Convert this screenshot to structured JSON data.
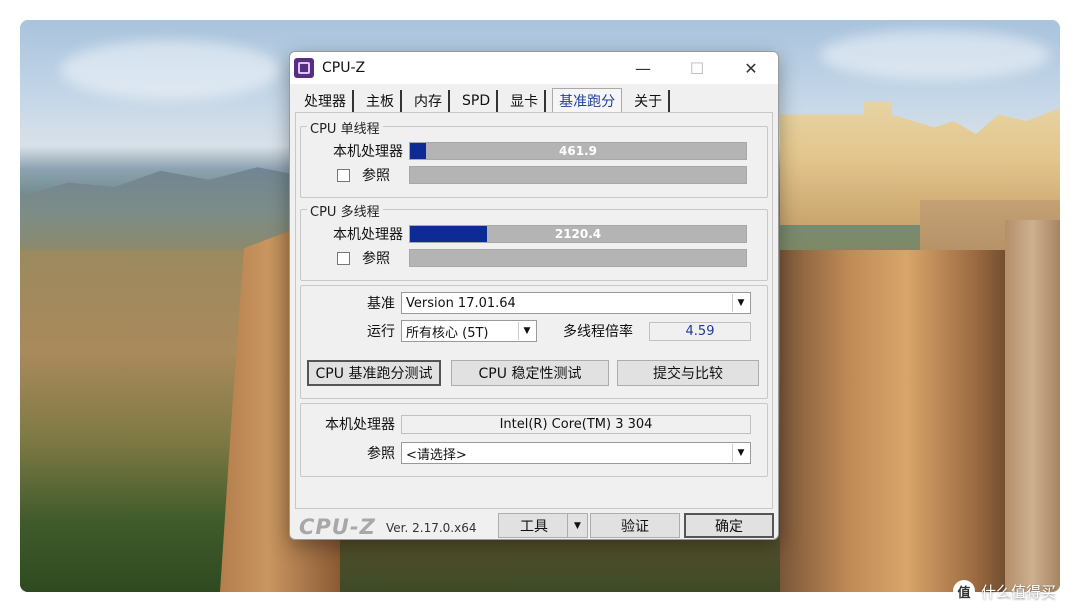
{
  "window": {
    "title": "CPU-Z",
    "minimize": "—",
    "maximize": "☐",
    "close": "✕"
  },
  "tabs": [
    {
      "label": "处理器",
      "active": false
    },
    {
      "label": "主板",
      "active": false
    },
    {
      "label": "内存",
      "active": false
    },
    {
      "label": "SPD",
      "active": false
    },
    {
      "label": "显卡",
      "active": false
    },
    {
      "label": "基准跑分",
      "active": true
    },
    {
      "label": "关于",
      "active": false
    }
  ],
  "single_thread": {
    "legend": "CPU 单线程",
    "this_label": "本机处理器",
    "this_value": "461.9",
    "this_fill": 0.047,
    "ref_label": "参照"
  },
  "multi_thread": {
    "legend": "CPU 多线程",
    "this_label": "本机处理器",
    "this_value": "2120.4",
    "this_fill": 0.23,
    "ref_label": "参照"
  },
  "settings": {
    "baseline_label": "基准",
    "baseline_value": "Version 17.01.64",
    "run_label": "运行",
    "run_value": "所有核心 (5T)",
    "ratio_label": "多线程倍率",
    "ratio_value": "4.59"
  },
  "actions": {
    "bench_button": "CPU 基准跑分测试",
    "stress_button": "CPU 稳定性测试",
    "submit_button": "提交与比较"
  },
  "processor": {
    "this_label": "本机处理器",
    "this_value": "Intel(R) Core(TM) 3 304",
    "ref_label": "参照",
    "ref_value": "<请选择>"
  },
  "footer": {
    "brand": "CPU-Z",
    "version": "Ver. 2.17.0.x64",
    "tools_button": "工具",
    "validate_button": "验证",
    "ok_button": "确定"
  },
  "watermark": {
    "logo": "值",
    "text": "什么值得买"
  },
  "colors": {
    "bar_fill": "#0e2a94",
    "bar_bg": "#b4b4b4",
    "active_tab_text": "#1f3fa0"
  }
}
